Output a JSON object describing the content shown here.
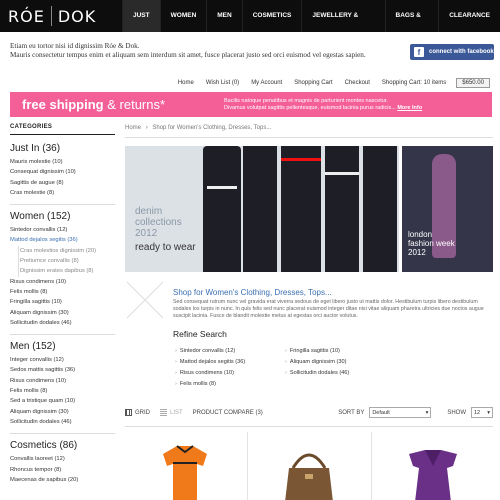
{
  "brand": {
    "part1": "RÓE",
    "part2": "DOK"
  },
  "nav": [
    "JUST IN",
    "WOMEN",
    "MEN",
    "COSMETICS",
    "JEWELLERY & ACCESSORIES",
    "BAGS & SHOES",
    "CLEARANCE"
  ],
  "intro": {
    "line1": "Etiam eu tortor nisi id dignissim Róe & Dok.",
    "line2": "Mauris consectetur tempus enim et aliquam sem interdum sit amet, fusce placerat justo sed orci euismod vel egestas sapien."
  },
  "facebook": {
    "label": "connect with facebook"
  },
  "utility": {
    "home": "Home",
    "wishlist": "Wish List (0)",
    "account": "My Account",
    "cart": "Shopping Cart",
    "checkout": "Checkout",
    "cart_summary": "Shopping Cart: 10 items",
    "cart_total": "$650.00"
  },
  "promo": {
    "headline_bold": "free shipping",
    "headline_rest": " & returns*",
    "line1": "Bacilis natoque penatibus et magnis de parturient montes nascetur.",
    "line2": "Divamus volutpat sagittis pellentesque, euismod lacinia purus radicis...",
    "more": "More Info"
  },
  "sidebar": {
    "title": "CATEGORIES",
    "groups": [
      {
        "name": "Just In (36)",
        "items": [
          "Mauris molestie (10)",
          "Consequat dignissim (10)",
          "Sagittis de augue (8)",
          "Cras molestie (8)"
        ]
      },
      {
        "name": "Women (152)",
        "items": [
          "Sintedor convallis (12)",
          "Mattod dejalos segitis (36)"
        ],
        "subitems": [
          "Cras molestios dignissim (20)",
          "Pretiumce convallis (8)",
          "Dignissim erates dapibus (8)"
        ],
        "more": [
          "Risus condimens (10)",
          "Felis mollis (8)",
          "Fringilla sagittis (10)",
          "Aliquam dignissim (30)",
          "Sollicitudin dodales (46)"
        ]
      },
      {
        "name": "Men (152)",
        "items": [
          "Integer convallis (12)",
          "Sedos mattis sagittis (36)",
          "Risus condimens (10)",
          "Felis mollis (8)",
          "Sed a tristique quam (10)",
          "Aliquam dignissim (30)",
          "Sollicitudin dodales (46)"
        ]
      },
      {
        "name": "Cosmetics (86)",
        "items": [
          "Convallis laoreet (12)",
          "Rhoncus tempor (8)",
          "Maecenas de sapibus (20)"
        ]
      }
    ]
  },
  "breadcrumb": {
    "home": "Home",
    "sep": "›",
    "current": "Shop for Women's Clothing, Dresses, Tops..."
  },
  "hero": {
    "line1": "denim",
    "line2": "collections",
    "line3": "2012",
    "tagline": "ready to wear"
  },
  "hero2": {
    "line1": "london",
    "line2": "fashion week",
    "line3": "2012"
  },
  "shop": {
    "title": "Shop for Women's Clothing, Dresses, Tops...",
    "body": "Sed consequat rutrum nunc vel gravida erat viverra sedous de eget libero justo ut mattis dolor. Hestibulum turpis libero destibulum sodales los turpis in nunc. In quis felis sed nunc placerat euismod integer ditae nisi vitae aliquam pharetra ultricies due noctos augue suscipit lacinia. Fusce de blandit molestie metus at egestas orci auctor volutus."
  },
  "refine": {
    "title": "Refine Search",
    "col1": [
      "Sintedor convallis (12)",
      "Mattod dejalos segitis (36)",
      "Risus condimens (10)",
      "Felis mollis (8)"
    ],
    "col2": [
      "Fringilla sagittis (10)",
      "Aliquam dignissim (30)",
      "Sollicitudin dodales (46)"
    ]
  },
  "toolbar": {
    "grid": "GRID",
    "list": "LIST",
    "compare": "PRODUCT COMPARE (3)",
    "sortby": "SORT BY",
    "sort_value": "Default",
    "show": "SHOW",
    "show_value": "12"
  },
  "colors": {
    "promo": "#f45f98",
    "link": "#3a6fb0",
    "facebook": "#3b5998",
    "topbar": "#0d0d0d"
  }
}
